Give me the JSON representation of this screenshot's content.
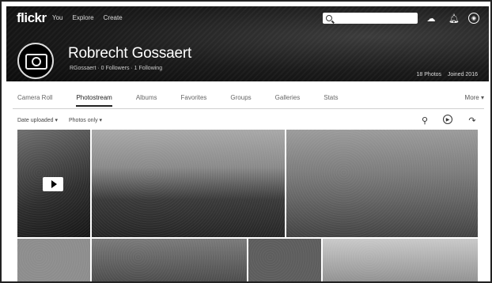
{
  "brand": {
    "logo": "flickr"
  },
  "nav": {
    "items": [
      "You",
      "Explore",
      "Create"
    ]
  },
  "search": {
    "placeholder": ""
  },
  "topicons": {
    "upload": "cloud-upload-icon",
    "notifications": "bell-icon",
    "account": "avatar-icon"
  },
  "profile": {
    "name": "Robrecht Gossaert",
    "meta": "RGossaert  ·  0 Followers  ·  1 Following",
    "photos": "18 Photos",
    "joined": "Joined 2016"
  },
  "tabs": [
    "Camera Roll",
    "Photostream",
    "Albums",
    "Favorites",
    "Groups",
    "Galleries",
    "Stats"
  ],
  "more": "More ▾",
  "filters": {
    "date": "Date uploaded ▾",
    "view": "Photos only ▾"
  },
  "ficons": {
    "search": "search-icon",
    "slideshow": "slideshow-icon",
    "share": "share-icon"
  }
}
